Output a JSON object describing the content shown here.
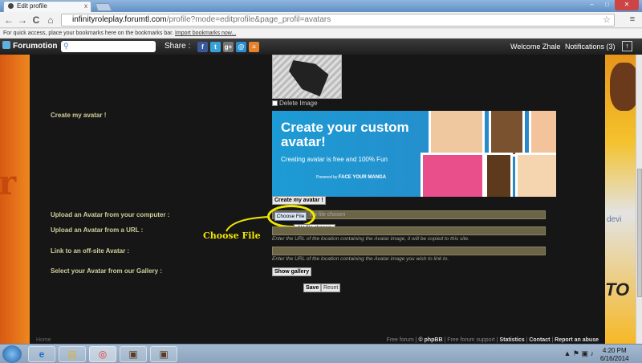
{
  "browser": {
    "tab_title": "Edit profile",
    "url_host": "infinityroleplay.forumtl.com",
    "url_path": "/profile?mode=editprofile&page_profil=avatars",
    "bookmarks_text": "For quick access, place your bookmarks here on the bookmarks bar.",
    "import_link": "Import bookmarks now...",
    "tab_close": "x",
    "win_min": "–",
    "win_max": "□",
    "win_close": "✕",
    "back": "←",
    "forward": "→",
    "reload": "C",
    "home": "⌂",
    "star": "☆",
    "menu": "≡"
  },
  "forumotion": {
    "logo": "Forumotion",
    "share_label": "Share :",
    "share_icons": [
      "f",
      "t",
      "g+",
      "@",
      "≡"
    ],
    "welcome": "Welcome Zhale",
    "notifications": "Notifications (3)",
    "up_arrow": "↑"
  },
  "background": {
    "left_text": "r",
    "right_text": "devi",
    "right_text2": "TO"
  },
  "avatar_form": {
    "delete_label": "Delete Image",
    "create_label": "Create my avatar !",
    "upload_computer_label": "Upload an Avatar from your computer :",
    "upload_url_label": "Upload an Avatar from a URL :",
    "offsite_label": "Link to an off-site Avatar :",
    "gallery_label": "Select your Avatar from our Gallery :",
    "create_button": "Create my avatar !",
    "choose_file_button": "Choose File",
    "no_file_chosen": "No file chosen",
    "tooltip": "No file chosen",
    "url_hint": "Enter the URL of the location containing the Avatar image, it will be copied to this site.",
    "offsite_hint": "Enter the URL of the location containing the Avatar image you wish to link to.",
    "show_gallery_button": "Show gallery",
    "save_button": "Save",
    "reset_button": "Reset"
  },
  "banner": {
    "headline_1": "Create your custom",
    "headline_2": "avatar!",
    "subline": "Creating avatar is free and 100% Fun",
    "powered_by": "Powered by",
    "brand": "FACE YOUR MANGA"
  },
  "annotation": {
    "text": "Choose File",
    "color": "#f1e600"
  },
  "footer": {
    "home": "Home",
    "free_forum": "Free forum",
    "copyright": "© phpBB",
    "support": "Free forum support",
    "statistics": "Statistics",
    "contact": "Contact",
    "report": "Report an abuse"
  },
  "taskbar": {
    "tray": "▲ ⚑ ▣ ♪",
    "time": "4:20 PM",
    "date": "6/16/2014",
    "items": [
      "e",
      "▤",
      "◎",
      "▣",
      "▣"
    ]
  }
}
